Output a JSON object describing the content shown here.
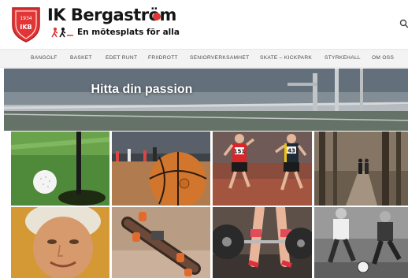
{
  "site": {
    "name": "IK Bergaström",
    "tagline": "En mötesplats för alla",
    "crest_year": "1934",
    "crest_initials": "IKB"
  },
  "nav": {
    "items": [
      {
        "label": "BANGOLF"
      },
      {
        "label": "BASKET"
      },
      {
        "label": "EDET RUNT"
      },
      {
        "label": "FRIIDROTT"
      },
      {
        "label": "SENIORVERKSAMHET"
      },
      {
        "label": "SKATE – KICKPARK"
      },
      {
        "label": "STYRKEHALL"
      },
      {
        "label": "OM OSS"
      }
    ]
  },
  "hero": {
    "title": "Hitta din passion"
  },
  "tiles": [
    {
      "icon": "golf-ball-photo"
    },
    {
      "icon": "basketball-photo"
    },
    {
      "icon": "youth-runners-photo",
      "bib_1": "151",
      "bib_2": "43"
    },
    {
      "icon": "forest-walk-photo"
    },
    {
      "icon": "senior-woman-photo"
    },
    {
      "icon": "skateboard-photo"
    },
    {
      "icon": "barbell-photo"
    },
    {
      "icon": "football-photo"
    }
  ],
  "colors": {
    "brand_red": "#e23636",
    "nav_background": "#f3f3f3",
    "nav_text": "#4b4b4b"
  }
}
